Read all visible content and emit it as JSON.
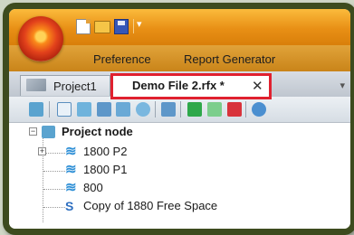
{
  "quick_access": {
    "dropdown_glyph": "▾",
    "icons": [
      "new-file-icon",
      "open-folder-icon",
      "save-icon"
    ]
  },
  "menu": {
    "items": [
      "Preference",
      "Report Generator"
    ]
  },
  "tabs": [
    {
      "label": "Project1",
      "active": false
    },
    {
      "label": "Demo File 2.rfx *",
      "active": true,
      "close_glyph": "✕"
    }
  ],
  "tab_overflow_glyph": "▾",
  "toolbar": {
    "icons": [
      "project-icon",
      "waveform-icon",
      "wave-icon",
      "document-icon",
      "grid-icon",
      "circle-icon",
      "s-icon",
      "play-icon",
      "step-icon",
      "stop-icon",
      "settings-icon"
    ]
  },
  "tree": {
    "root": {
      "label": "Project node",
      "expander": "−"
    },
    "children": [
      {
        "label": "1800 P2",
        "expander": "+",
        "icon": "wave-icon"
      },
      {
        "label": "1800 P1",
        "icon": "wave-icon"
      },
      {
        "label": "800",
        "icon": "wave-icon"
      },
      {
        "label": "Copy of 1880 Free Space",
        "icon": "s-icon"
      }
    ]
  },
  "colors": {
    "ribbon_orange": "#e88f15",
    "highlight_red": "#e0212f",
    "frame": "#3d4b1e"
  }
}
